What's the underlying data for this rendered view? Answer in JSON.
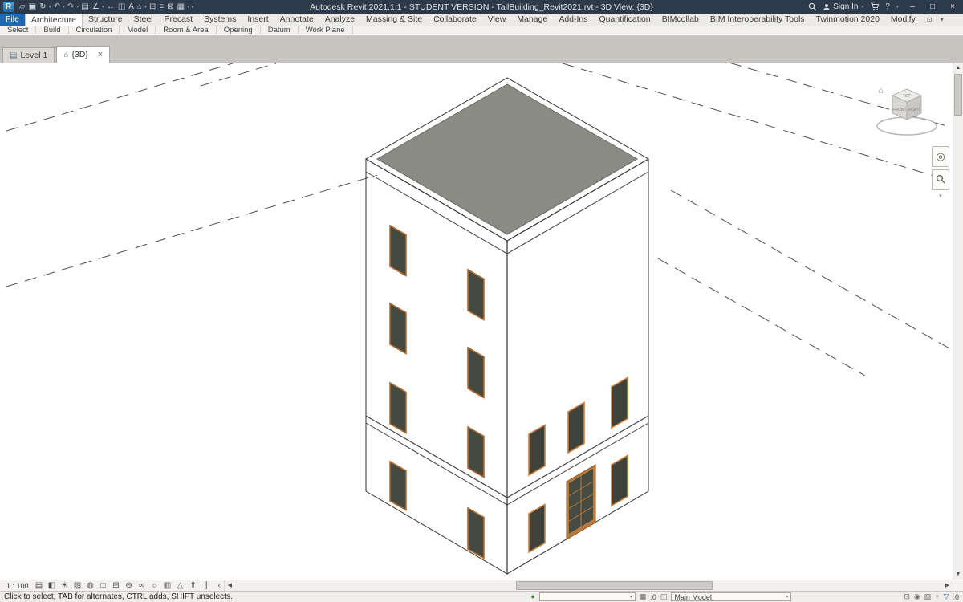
{
  "window": {
    "title": "Autodesk Revit 2021.1.1 - STUDENT VERSION - TallBuilding_Revit2021.rvt - 3D View: {3D}"
  },
  "titlebar": {
    "logo": "R",
    "qat": [
      {
        "name": "open-icon",
        "glyph": "▱"
      },
      {
        "name": "save-icon",
        "glyph": "▣"
      },
      {
        "name": "sync-icon",
        "glyph": "↻"
      },
      {
        "name": "sync-caret",
        "glyph": "▾"
      },
      {
        "name": "undo-icon",
        "glyph": "↶"
      },
      {
        "name": "undo-caret",
        "glyph": "▾"
      },
      {
        "name": "redo-icon",
        "glyph": "↷"
      },
      {
        "name": "redo-caret",
        "glyph": "▾"
      },
      {
        "name": "print-icon",
        "glyph": "▤"
      },
      {
        "name": "measure-icon",
        "glyph": "∠"
      },
      {
        "name": "measure-caret",
        "glyph": "▾"
      },
      {
        "name": "aligned-dimension-icon",
        "glyph": "↔"
      },
      {
        "name": "tag-by-category-icon",
        "glyph": "◫"
      },
      {
        "name": "text-icon",
        "glyph": "A"
      },
      {
        "name": "default-3d-view-icon",
        "glyph": "⌂"
      },
      {
        "name": "default-3d-view-caret",
        "glyph": "▾"
      },
      {
        "name": "section-icon",
        "glyph": "⊟"
      },
      {
        "name": "thin-lines-icon",
        "glyph": "≡"
      },
      {
        "name": "close-hidden-windows-icon",
        "glyph": "⊠"
      },
      {
        "name": "switch-windows-icon",
        "glyph": "▦"
      },
      {
        "name": "switch-windows-caret",
        "glyph": "▾"
      },
      {
        "name": "customize-qat-icon",
        "glyph": "▾"
      }
    ],
    "signin_label": "Sign In",
    "signin_caret": "▾",
    "help_glyph": "?",
    "help_caret": "▾",
    "minimize_glyph": "–",
    "restore_glyph": "□",
    "close_glyph": "×"
  },
  "ribbon": {
    "tabs": [
      {
        "label": "File"
      },
      {
        "label": "Architecture"
      },
      {
        "label": "Structure"
      },
      {
        "label": "Steel"
      },
      {
        "label": "Precast"
      },
      {
        "label": "Systems"
      },
      {
        "label": "Insert"
      },
      {
        "label": "Annotate"
      },
      {
        "label": "Analyze"
      },
      {
        "label": "Massing & Site"
      },
      {
        "label": "Collaborate"
      },
      {
        "label": "View"
      },
      {
        "label": "Manage"
      },
      {
        "label": "Add-Ins"
      },
      {
        "label": "Quantification"
      },
      {
        "label": "BIMcollab"
      },
      {
        "label": "BIM Interoperability Tools"
      },
      {
        "label": "Twinmotion 2020"
      },
      {
        "label": "Modify"
      }
    ],
    "toggle_glyph": "⊡",
    "toggle_caret": "▾",
    "panels": [
      "Select",
      "Build",
      "Circulation",
      "Model",
      "Room & Area",
      "Opening",
      "Datum",
      "Work Plane"
    ]
  },
  "view_tabs": {
    "level1": {
      "icon": "▤",
      "label": "Level 1"
    },
    "view3d": {
      "icon": "⌂",
      "label": "{3D}",
      "close": "×"
    }
  },
  "viewcube": {
    "top": "TOP",
    "front": "FRONT",
    "right": "RIGHT",
    "home_glyph": "⌂"
  },
  "navigation_bar": {
    "wheel_glyph": "◎",
    "caret_glyph": "▾"
  },
  "view_control_bar": {
    "scale": "1 : 100",
    "icons": [
      {
        "name": "detail-level-icon",
        "glyph": "▤"
      },
      {
        "name": "visual-style-icon",
        "glyph": "◧"
      },
      {
        "name": "sun-path-icon",
        "glyph": "☀"
      },
      {
        "name": "shadows-icon",
        "glyph": "▨"
      },
      {
        "name": "rendering-dialog-icon",
        "glyph": "◍"
      },
      {
        "name": "crop-view-icon",
        "glyph": "□"
      },
      {
        "name": "show-crop-region-icon",
        "glyph": "⊞"
      },
      {
        "name": "lock-3d-view-icon",
        "glyph": "⊖"
      },
      {
        "name": "temporary-hide-isolate-icon",
        "glyph": "∞"
      },
      {
        "name": "reveal-hidden-elements-icon",
        "glyph": "☼"
      },
      {
        "name": "temporary-view-properties-icon",
        "glyph": "▥"
      },
      {
        "name": "analytical-model-icon",
        "glyph": "△"
      },
      {
        "name": "displacement-sets-icon",
        "glyph": "⇑"
      },
      {
        "name": "reveal-constraints-icon",
        "glyph": "∥"
      }
    ],
    "tab_scroll_glyph": "‹"
  },
  "scrollbars": {
    "up": "▲",
    "down": "▼",
    "left": "◀",
    "right": "▶"
  },
  "status_bar": {
    "hint": "Click to select, TAB for alternates, CTRL adds, SHIFT unselects.",
    "workset_glyph": "●",
    "workset_value": "",
    "editable_glyph": "▦",
    "editable_count": ":0",
    "design_options_glyph": "◫",
    "design_options_value": "Main Model",
    "selection_toggles": [
      {
        "name": "select-links-icon",
        "glyph": "⊡"
      },
      {
        "name": "select-pinned-icon",
        "glyph": "◉"
      },
      {
        "name": "select-by-face-icon",
        "glyph": "▧"
      },
      {
        "name": "drag-on-selection-icon",
        "glyph": "+"
      },
      {
        "name": "filter-icon",
        "glyph": "▽"
      }
    ],
    "filter_count": ":0"
  },
  "colors": {
    "titlebar_bg": "#2c3a49",
    "file_tab_blue": "#1f69b3",
    "canvas_bg": "#ffffff",
    "wall_left": "#5c5f55",
    "wall_right": "#747767",
    "roof": "#929389",
    "roof_inner": "#8a8b82",
    "window_frame_left": "#b06a32",
    "window_frame_right": "#cd7e3c",
    "window_glass": "#454a40",
    "door_frame": "#b97a3e"
  }
}
